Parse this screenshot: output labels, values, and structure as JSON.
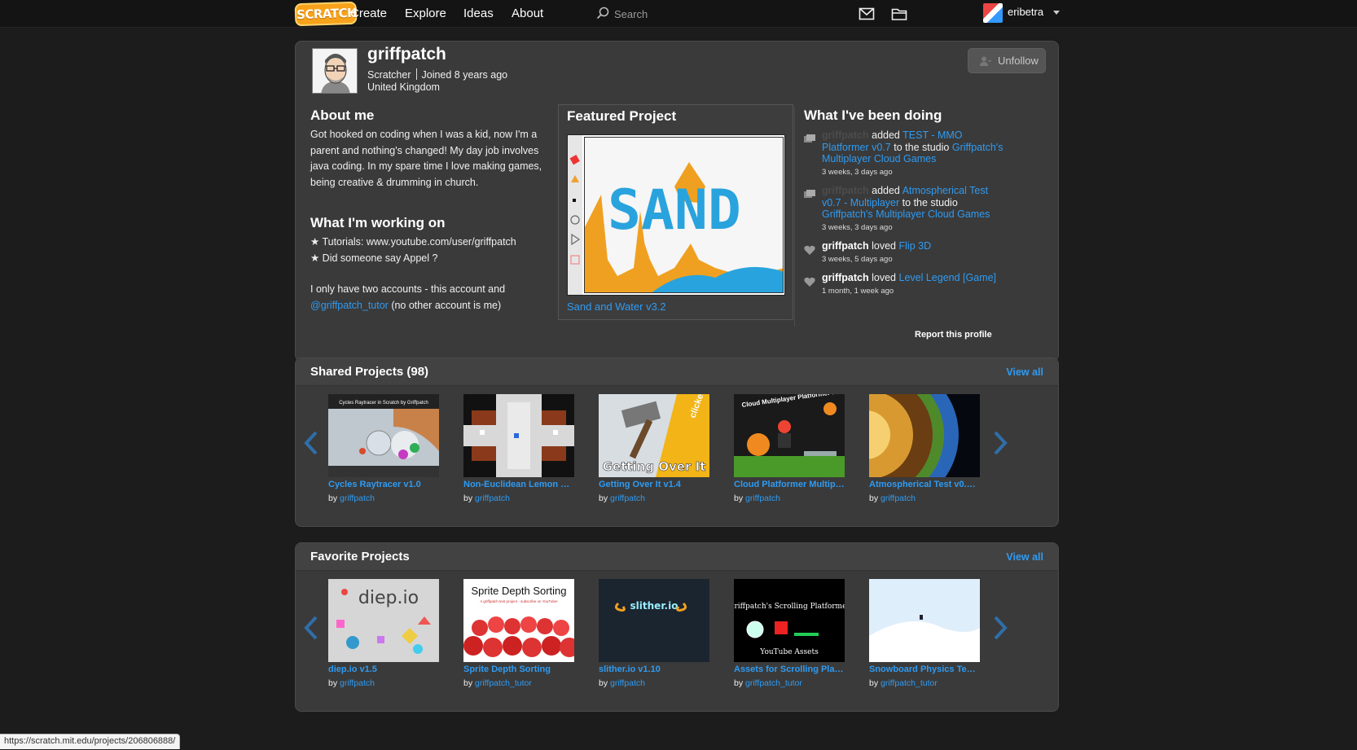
{
  "nav": {
    "logo": "SCRATCH",
    "items": [
      "Create",
      "Explore",
      "Ideas",
      "About"
    ],
    "search_placeholder": "Search",
    "username": "eribetra"
  },
  "profile": {
    "username": "griffpatch",
    "role": "Scratcher",
    "joined": "Joined 8 years ago",
    "location": "United Kingdom",
    "unfollow_label": "Unfollow",
    "about_title": "About me",
    "about_lines": [
      "Got hooked on coding when I was a kid, now I'm a",
      "parent and nothing's changed! My day job involves",
      "java coding. In my spare time I love making games,",
      "being creative & drumming in church."
    ],
    "working_title": "What I'm working on",
    "working_line1": "★ Tutorials: www.youtube.com/user/griffpatch",
    "working_line2": "★ Did someone say Appel ?",
    "accounts_line1": "I only have two accounts - this account and",
    "accounts_link": "@griffpatch_tutor",
    "accounts_line2": " (no other account is me)",
    "featured_title": "Featured Project",
    "featured_project": "Sand and Water v3.2",
    "featured_canvas_text": "SAND",
    "activity_title": "What I've been doing",
    "report_label": "Report this profile"
  },
  "activity": [
    {
      "actor": "griffpatch",
      "verb": "added",
      "project": "TEST - MMO Platformer v0.7",
      "mid": "to the studio",
      "studio": "Griffpatch's Multiplayer Cloud Games",
      "time": "3 weeks, 3 days ago",
      "icon": "studio-icon"
    },
    {
      "actor": "griffpatch",
      "verb": "added",
      "project": "Atmospherical Test v0.7 - Multiplayer",
      "mid": "to the studio",
      "studio": "Griffpatch's Multiplayer Cloud Games",
      "time": "3 weeks, 3 days ago",
      "icon": "studio-icon"
    },
    {
      "actor": "griffpatch",
      "verb": "loved",
      "project": "Flip 3D",
      "time": "3 weeks, 5 days ago",
      "icon": "heart-icon"
    },
    {
      "actor": "griffpatch",
      "verb": "loved",
      "project": "Level Legend [Game]",
      "time": "1 month, 1 week ago",
      "icon": "heart-icon"
    }
  ],
  "shared": {
    "title": "Shared Projects (98)",
    "view_all": "View all",
    "projects": [
      {
        "title": "Cycles Raytracer v1.0",
        "by": "by",
        "author": "griffpatch",
        "thumb_caption": "Cycles Raytracer in Scratch by Griffpatch"
      },
      {
        "title": "Non-Euclidean Lemon Gr...",
        "by": "by",
        "author": "griffpatch"
      },
      {
        "title": "Getting Over It v1.4",
        "by": "by",
        "author": "griffpatch",
        "thumb_caption": "Getting Over It",
        "thumb_badge": "clicked"
      },
      {
        "title": "Cloud Platformer Multipl...",
        "by": "by",
        "author": "griffpatch",
        "thumb_caption": "Cloud Multiplayer Platformer Fun!"
      },
      {
        "title": "Atmospherical Test v0.7 -...",
        "by": "by",
        "author": "griffpatch"
      }
    ]
  },
  "favorites": {
    "title": "Favorite Projects",
    "view_all": "View all",
    "projects": [
      {
        "title": "diep.io v1.5",
        "by": "by",
        "author": "griffpatch",
        "thumb_caption": "diep.io"
      },
      {
        "title": "Sprite Depth Sorting",
        "by": "by",
        "author": "griffpatch_tutor",
        "thumb_caption": "Sprite Depth Sorting",
        "thumb_sub": "A griffpatch test project - subscribe on YouTube!"
      },
      {
        "title": "slither.io v1.10",
        "by": "by",
        "author": "griffpatch",
        "thumb_caption": "slither.io"
      },
      {
        "title": "Assets for Scrolling Platf...",
        "by": "by",
        "author": "griffpatch_tutor",
        "thumb_caption": "Griffpatch's Scrolling Platformer",
        "thumb_sub": "YouTube Assets"
      },
      {
        "title": "Snowboard Physics Test ...",
        "by": "by",
        "author": "griffpatch_tutor"
      }
    ]
  },
  "statusbar": "https://scratch.mit.edu/projects/206806888/",
  "colors": {
    "link": "#2f9bf2",
    "panel": "#3a3a3a",
    "background": "#1c1c1c"
  }
}
